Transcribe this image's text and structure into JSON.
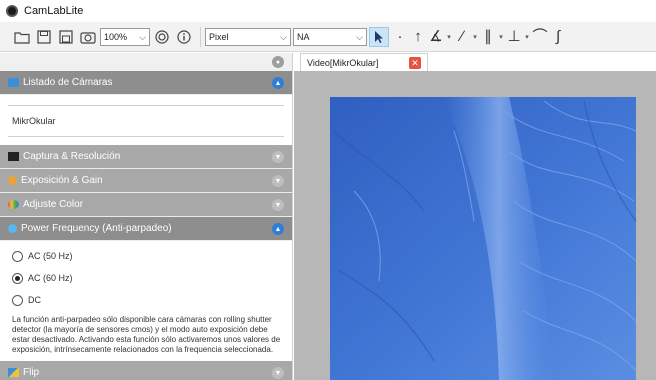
{
  "app": {
    "title": "CamLabLite"
  },
  "toolbar": {
    "zoom": "100%",
    "unit": "Pixel",
    "objective": "NA",
    "icons": [
      "folder-icon",
      "save-icon",
      "save-all-icon",
      "snapshot-icon",
      "zoom-select",
      "settings-icon",
      "info-icon",
      "pointer-icon",
      "arrow-tool-icon",
      "angle-tool-icon",
      "line-tool-icon",
      "parallel-tool-icon",
      "perpendicular-tool-icon",
      "arc-tool-icon",
      "curve-tool-icon"
    ]
  },
  "panel": {
    "sections": {
      "cameras": {
        "label": "Listado de Cámaras",
        "item": "MikrOkular"
      },
      "capture": {
        "label": "Captura & Resolución"
      },
      "exposure": {
        "label": "Exposición & Gain"
      },
      "color": {
        "label": "Adjuste Color"
      },
      "power": {
        "label": "Power Frequency (Anti-parpadeo)",
        "options": [
          "AC (50 Hz)",
          "AC (60 Hz)",
          "DC"
        ],
        "selected": "AC (60 Hz)",
        "help": "La función anti-parpadeo sólo disponible cara cámaras con rolling shutter detector (la mayoría de sensores cmos) y el modo auto exposición debe estar desactivado. Activando esta función sólo activaremos unos valores de exposición, intrínsecamente relacionados con la frequencia seleccionada."
      },
      "flip": {
        "label": "Flip"
      }
    }
  },
  "viewer": {
    "tab_label": "Video[MikrOkular]",
    "accent": "#3f74d4",
    "colors": {
      "image_blue": "#3f74d4",
      "image_light": "#7aa6ec",
      "close": "#e8533f"
    }
  }
}
